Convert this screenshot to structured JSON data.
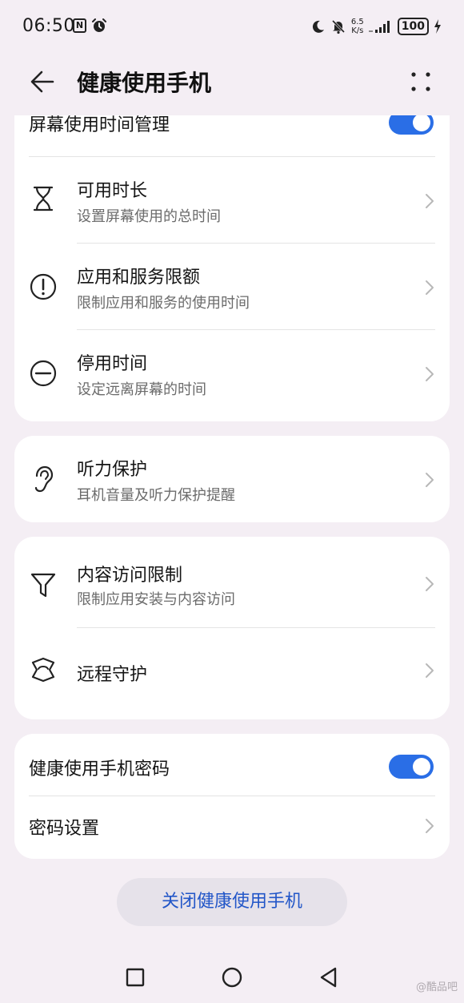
{
  "status_bar": {
    "time": "06:50",
    "nfc": "N",
    "speed_top": "6.5",
    "speed_bottom": "K/s",
    "battery": "100",
    "icons": [
      "nfc-icon",
      "alarm-icon",
      "moon-icon",
      "mute-bell-icon",
      "signal-icon",
      "battery-icon",
      "charging-icon"
    ]
  },
  "header": {
    "title": "健康使用手机",
    "back_icon": "arrow-left-icon",
    "more_icon": "more-dots-icon"
  },
  "card1": {
    "toggle_label": "屏幕使用时间管理",
    "toggle_on": true,
    "items": [
      {
        "title": "可用时长",
        "subtitle": "设置屏幕使用的总时间",
        "icon": "hourglass-icon"
      },
      {
        "title": "应用和服务限额",
        "subtitle": "限制应用和服务的使用时间",
        "icon": "alert-circle-icon"
      },
      {
        "title": "停用时间",
        "subtitle": "设定远离屏幕的时间",
        "icon": "minus-circle-icon"
      }
    ]
  },
  "card2": {
    "items": [
      {
        "title": "听力保护",
        "subtitle": "耳机音量及听力保护提醒",
        "icon": "ear-icon"
      }
    ]
  },
  "card3": {
    "items": [
      {
        "title": "内容访问限制",
        "subtitle": "限制应用安装与内容访问",
        "icon": "filter-icon"
      },
      {
        "title": "远程守护",
        "icon": "remote-guard-icon"
      }
    ]
  },
  "card4": {
    "password_toggle_label": "健康使用手机密码",
    "password_toggle_on": true,
    "password_settings_label": "密码设置"
  },
  "close_button_label": "关闭健康使用手机",
  "nav": {
    "icons": [
      "recent-apps-icon",
      "home-icon",
      "back-icon"
    ]
  },
  "watermark": "@酷品吧",
  "colors": {
    "accent": "#2a6ee6",
    "button_text": "#2256c8",
    "background": "#f4eef4",
    "card": "#ffffff"
  }
}
